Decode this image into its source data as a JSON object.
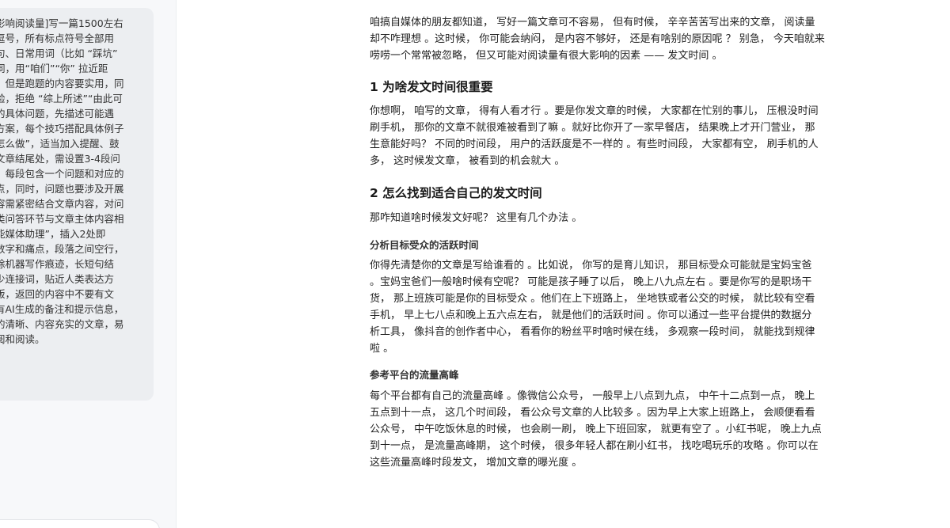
{
  "sidebar": {
    "prompt_lines": [
      "影响阅读量]写一篇1500左右",
      "逗号，所有标点符号全部用",
      "句、日常用词（比如 “踩坑”",
      "词，用“咱们”“你” 拉近距",
      "，但是跑题的内容要实用，同",
      "验，拒绝 “综上所述”“由此可",
      "的具体问题，先描述可能遇",
      "方案，每个技巧搭配具体例子",
      "怎么做”，适当加入提醒、鼓",
      "文章结尾处，需设置3-4段问",
      "，每段包含一个问题和对应的",
      "点，同时，问题也要涉及开展",
      "容需紧密结合文章内容，对问",
      "类问答环节与文章主体内容相",
      "能媒体助理”，插入2处即",
      "数字和痛点，段落之间空行，",
      "除机器写作痕迹，长短句结",
      "少连接词，贴近人类表达方",
      "版，返回的内容中不要有文",
      "有AI生成的备注和提示信息，",
      "的清晰、内容充实的文章，易",
      "阅和阅读。"
    ]
  },
  "article": {
    "intro_lines": [
      "咱搞自媒体的朋友都知道， 写好一篇文章可不容易， 但有时候， 辛辛苦苦写出来的文章， 阅读量",
      "却不咋理想 。这时候， 你可能会纳闷， 是内容不够好， 还是有啥别的原因呢 ？ 别急， 今天咱就来",
      "唠唠一个常常被忽略， 但又可能对阅读量有很大影响的因素 —— 发文时间 。"
    ],
    "section1_title": "1 为啥发文时间很重要",
    "section1_lines": [
      "你想啊， 咱写的文章， 得有人看才行 。要是你发文章的时候， 大家都在忙别的事儿， 压根没时间",
      "刷手机， 那你的文章不就很难被看到了嘛 。就好比你开了一家早餐店， 结果晚上才开门营业， 那",
      "生意能好吗？ 不同的时间段， 用户的活跃度是不一样的 。有些时间段， 大家都有空， 刷手机的人",
      "多， 这时候发文章， 被看到的机会就大 。"
    ],
    "section2_title": "2 怎么找到适合自己的发文时间",
    "section2_intro": "那咋知道啥时候发文好呢？ 这里有几个办法 。",
    "sub1_title": "分析目标受众的活跃时间",
    "sub1_lines": [
      "你得先清楚你的文章是写给谁看的 。比如说， 你写的是育儿知识， 那目标受众可能就是宝妈宝爸",
      "。宝妈宝爸们一般啥时候有空呢？ 可能是孩子睡了以后， 晚上八九点左右 。要是你写的是职场干",
      "货， 那上班族可能是你的目标受众 。他们在上下班路上， 坐地铁或者公交的时候， 就比较有空看",
      "手机， 早上七八点和晚上五六点左右， 就是他们的活跃时间 。你可以通过一些平台提供的数据分",
      "析工具， 像抖音的创作者中心， 看看你的粉丝平时啥时候在线， 多观察一段时间， 就能找到规律",
      "啦 。"
    ],
    "sub2_title": "参考平台的流量高峰",
    "sub2_lines": [
      "每个平台都有自己的流量高峰 。像微信公众号， 一般早上八点到九点， 中午十二点到一点， 晚上",
      "五点到十一点， 这几个时间段， 看公众号文章的人比较多 。因为早上大家上班路上， 会顺便看看",
      "公众号， 中午吃饭休息的时候， 也会刷一刷， 晚上下班回家， 就更有空了 。小红书呢， 晚上九点",
      "到十一点， 是流量高峰期， 这个时候， 很多年轻人都在刷小红书， 找吃喝玩乐的攻略 。你可以在",
      "这些流量高峰时段发文， 增加文章的曝光度 。"
    ]
  }
}
